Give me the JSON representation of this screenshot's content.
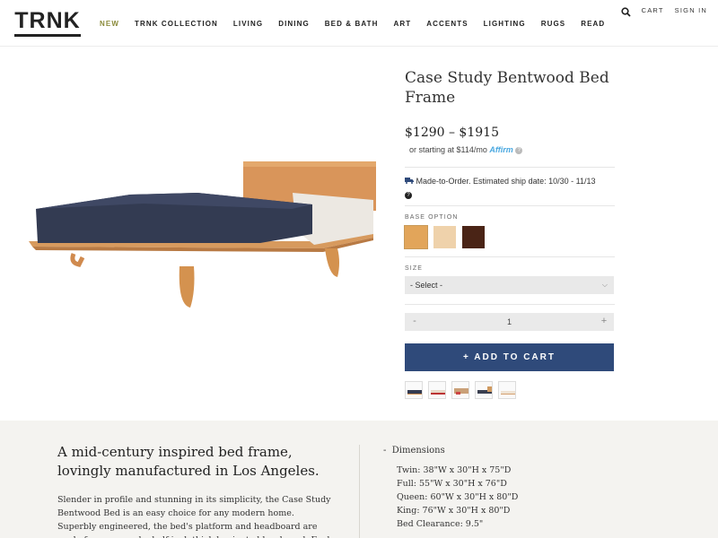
{
  "header": {
    "logo": "TRNK",
    "nav": [
      "NEW",
      "TRNK COLLECTION",
      "LIVING",
      "DINING",
      "BED & BATH",
      "ART",
      "ACCENTS",
      "LIGHTING",
      "RUGS",
      "READ"
    ],
    "cart_label": "CART",
    "signin_label": "SIGN IN",
    "search_icon": "search-icon"
  },
  "product": {
    "title": "Case Study Bentwood Bed Frame",
    "price": "$1290 – $1915",
    "financing_prefix": "or starting at $114/mo",
    "financing_brand": "Affirm",
    "shipping": "Made-to-Order. Estimated ship date: 10/30 - 11/13",
    "base_option_label": "BASE OPTION",
    "swatch_colors": [
      "#e2a55a",
      "#efd2ab",
      "#4a2416"
    ],
    "size_label": "SIZE",
    "size_selected": "- Select -",
    "quantity_minus": "-",
    "quantity": "1",
    "quantity_plus": "+",
    "add_to_cart": "+ ADD TO CART",
    "brand_color": "#2f4a7a"
  },
  "details": {
    "tagline": "A mid-century inspired bed frame, lovingly manufactured in Los Angeles.",
    "description": "Slender in profile and stunning in its simplicity, the Case Study Bentwood Bed is an easy choice for any modern home. Superbly engineered, the bed's platform and headboard are made from one and a half inch thick laminated hardwood. Each bed comes",
    "dimensions_title": "Dimensions",
    "dimensions": [
      "Twin: 38\"W x 30\"H x 75\"D",
      "Full: 55\"W x 30\"H x 76\"D",
      "Queen: 60\"W x 30\"H x 80\"D",
      "King: 76\"W x 30\"H x 80\"D",
      "Bed Clearance: 9.5\""
    ]
  }
}
